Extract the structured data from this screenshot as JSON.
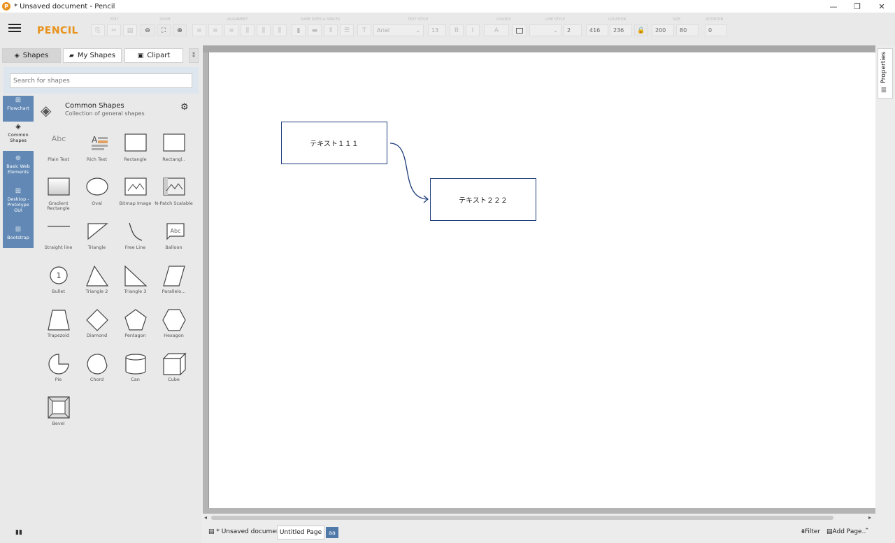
{
  "window": {
    "title": "* Unsaved document - Pencil",
    "icon_glyph": "P",
    "minimize": "—",
    "maximize": "❐",
    "close": "✕"
  },
  "app": {
    "logo": "PENCIL"
  },
  "toolbar": {
    "groups": [
      "EDIT",
      "ZOOM",
      "ALIGNMENT",
      "SAME SIZES & SPACES",
      "TEXT STYLE",
      "COLORS",
      "LINE STYLE",
      "LOCATION",
      "SIZE",
      "ROTATION"
    ],
    "font": "Arial",
    "font_size": "13",
    "line_width": "2",
    "location_x": "416",
    "location_y": "236",
    "size_w": "200",
    "size_h": "80",
    "rotation": "0"
  },
  "left_tabs": [
    {
      "label": "Shapes",
      "icon": "layers-icon",
      "glyph": "◈"
    },
    {
      "label": "My Shapes",
      "icon": "briefcase-icon",
      "glyph": "▰"
    },
    {
      "label": "Clipart",
      "icon": "image-icon",
      "glyph": "▣"
    }
  ],
  "pin_glyph": "⁑",
  "search": {
    "placeholder": "Search for shapes"
  },
  "collections": [
    {
      "label": "Flowchart",
      "glyph": "⊞"
    },
    {
      "label": "Common Shapes",
      "glyph": "◈"
    },
    {
      "label": "Basic Web Elements",
      "glyph": "⊕"
    },
    {
      "label": "Desktop - Prototype GUI",
      "glyph": "⊞"
    },
    {
      "label": "Bootstrap",
      "glyph": "⊞"
    }
  ],
  "collection": {
    "title": "Common Shapes",
    "description": "Collection of general shapes",
    "header_glyph": "◈",
    "gear_glyph": "⚙"
  },
  "shapes": [
    "Plain Text",
    "Rich Text",
    "Rectangle",
    "Rectangl..",
    "Gradient Rectangle",
    "Oval",
    "Bitmap Image",
    "N-Patch Scalable",
    "Straight line",
    "Triangle",
    "Free Line",
    "Balloon",
    "Bullet",
    "Triangle 2",
    "Triangle 3",
    "Parallelo...",
    "Trapezoid",
    "Diamond",
    "Pentagon",
    "Hexagon",
    "Pie",
    "Chord",
    "Can",
    "Cube",
    "Bevel"
  ],
  "shape_glyphs": {
    "plain_text": "Abc",
    "balloon": "Abc",
    "bullet": "1"
  },
  "canvas": {
    "box1_text": "テキスト１１１",
    "box2_text": "テキスト２２２"
  },
  "properties": {
    "label": "Properties",
    "glyph": "☰"
  },
  "statusbar": {
    "doc_name": "* Unsaved document",
    "doc_glyph": "▤",
    "page_name": "Untitled Page",
    "page_badge": "aa",
    "filter": "Filter",
    "filter_glyph": "⩩",
    "add_page": "Add Page..",
    "add_page_glyph": "▤",
    "chevron": "⌃"
  },
  "scroll": {
    "left_arrow": "◂",
    "right_arrow": "▸"
  },
  "bottom_left_glyph": "▮▮"
}
